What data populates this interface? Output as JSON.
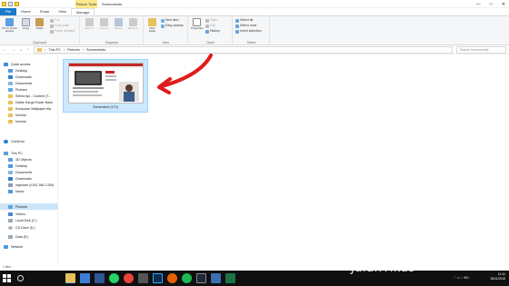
{
  "window": {
    "title": "Screenshots",
    "context_tab": "Picture Tools",
    "controls": [
      "—",
      "□",
      "✕"
    ]
  },
  "ribbon_tabs": [
    "File",
    "Home",
    "Share",
    "View",
    "Manage"
  ],
  "ribbon": {
    "clipboard": {
      "label": "Clipboard",
      "pin": "Pin to Quick access",
      "copy": "Copy",
      "paste": "Paste",
      "cut": "Cut",
      "copy_path": "Copy path",
      "paste_shortcut": "Paste shortcut"
    },
    "organize": {
      "label": "Organize",
      "move_to": "Move to",
      "copy_to": "Copy to",
      "delete": "Delete",
      "rename": "Rename"
    },
    "new": {
      "label": "New",
      "new_folder": "New folder",
      "new_item": "New item",
      "easy_access": "Easy access"
    },
    "open": {
      "label": "Open",
      "properties": "Properties",
      "open": "Open",
      "edit": "Edit",
      "history": "History"
    },
    "select": {
      "label": "Select",
      "select_all": "Select all",
      "select_none": "Select none",
      "invert": "Invert selection"
    }
  },
  "address": {
    "path": [
      "This PC",
      "Pictures",
      "Screenshots"
    ],
    "search_placeholder": "Search Screenshots"
  },
  "nav": {
    "items": [
      {
        "label": "Quick access"
      },
      {
        "label": "Desktop"
      },
      {
        "label": "Downloads"
      },
      {
        "label": "Documents"
      },
      {
        "label": "Pictures"
      },
      {
        "label": "Selma Api - Content (T..."
      },
      {
        "label": "Daftar Harga Power Bank"
      },
      {
        "label": "Kumpulan Wallpaper bla"
      },
      {
        "label": "Normal"
      },
      {
        "label": "Normal"
      },
      {
        "label": "OneDrive"
      },
      {
        "label": "This PC"
      },
      {
        "label": "3D Objects"
      },
      {
        "label": "Desktop"
      },
      {
        "label": "Documents"
      },
      {
        "label": "Downloads"
      },
      {
        "label": "mgshare (\\\\192.168.1.254)"
      },
      {
        "label": "Music"
      },
      {
        "label": "Pictures"
      },
      {
        "label": "Videos"
      },
      {
        "label": "Local Disk (C:)"
      },
      {
        "label": "CD Drive (D:)"
      },
      {
        "label": "Data (E:)"
      },
      {
        "label": "Network"
      }
    ]
  },
  "file": {
    "name": "Screenshot (170)"
  },
  "status": {
    "items": "1 item"
  },
  "taskbar": {
    "brand": "JalanTikus",
    "time": "11:41",
    "date": "18/11/2018",
    "lang": "IND",
    "icons": [
      "file-explorer",
      "store",
      "word",
      "whatsapp",
      "chrome",
      "camera",
      "photoshop",
      "firefox",
      "spotify",
      "steam",
      "pictures",
      "excel"
    ]
  },
  "colors": {
    "accent": "#1979ca",
    "selection": "#cce8ff",
    "arrow": "#e01b1b",
    "taskbar": "#101010",
    "folder": "#e8c15a"
  }
}
